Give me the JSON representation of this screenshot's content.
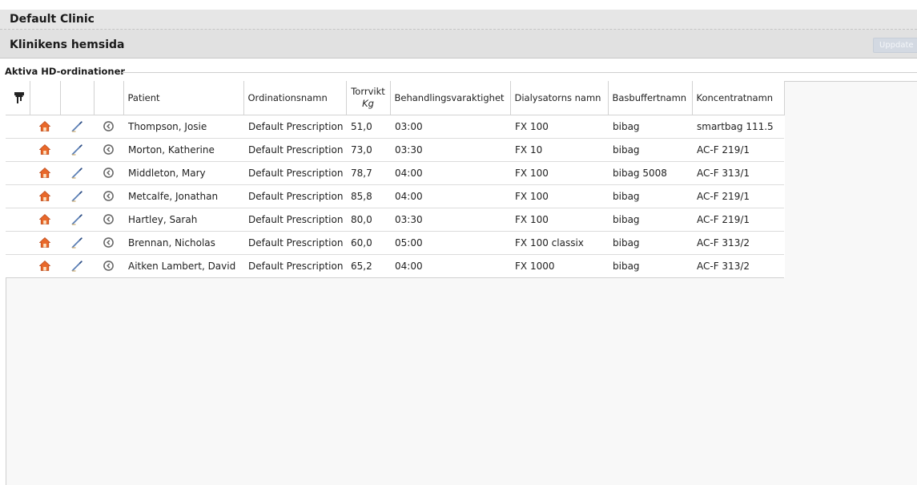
{
  "header": {
    "clinic_name": "Default Clinic",
    "home_title": "Klinikens hemsida",
    "update_label": "Uppdate"
  },
  "section": {
    "title": "Aktiva HD-ordinationer"
  },
  "table": {
    "columns": {
      "patient": "Patient",
      "prescription": "Ordinationsnamn",
      "dry_weight": "Torrvikt",
      "dry_weight_unit": "Kg",
      "duration": "Behandlingsvaraktighet",
      "dialyzer": "Dialysatorns namn",
      "base_buffer": "Basbuffertnamn",
      "concentrate": "Koncentratnamn"
    },
    "rows": [
      {
        "patient": "Thompson, Josie",
        "prescription": "Default Prescription",
        "dry_weight": "51,0",
        "duration": "03:00",
        "dialyzer": "FX 100",
        "base_buffer": "bibag",
        "concentrate": "smartbag 111.5"
      },
      {
        "patient": "Morton, Katherine",
        "prescription": "Default Prescription",
        "dry_weight": "73,0",
        "duration": "03:30",
        "dialyzer": "FX 10",
        "base_buffer": "bibag",
        "concentrate": "AC-F 219/1"
      },
      {
        "patient": "Middleton, Mary",
        "prescription": "Default Prescription",
        "dry_weight": "78,7",
        "duration": "04:00",
        "dialyzer": "FX 100",
        "base_buffer": "bibag 5008",
        "concentrate": "AC-F 313/1"
      },
      {
        "patient": "Metcalfe, Jonathan",
        "prescription": "Default Prescription",
        "dry_weight": "85,8",
        "duration": "04:00",
        "dialyzer": "FX 100",
        "base_buffer": "bibag",
        "concentrate": "AC-F 219/1"
      },
      {
        "patient": "Hartley, Sarah",
        "prescription": "Default Prescription",
        "dry_weight": "80,0",
        "duration": "03:30",
        "dialyzer": "FX 100",
        "base_buffer": "bibag",
        "concentrate": "AC-F 219/1"
      },
      {
        "patient": "Brennan, Nicholas",
        "prescription": "Default Prescription",
        "dry_weight": "60,0",
        "duration": "05:00",
        "dialyzer": "FX 100 classix",
        "base_buffer": "bibag",
        "concentrate": "AC-F 313/2"
      },
      {
        "patient": "Aitken Lambert, David",
        "prescription": "Default Prescription",
        "dry_weight": "65,2",
        "duration": "04:00",
        "dialyzer": "FX 1000",
        "base_buffer": "bibag",
        "concentrate": "AC-F 313/2"
      }
    ]
  },
  "icons": {
    "filter": "filter-icon",
    "home": "home-icon",
    "pen": "pen-icon",
    "clock": "clock-icon"
  },
  "colors": {
    "home_icon": "#e8682a",
    "pen_icon": "#5b7fb5",
    "clock_icon": "#6b6b6b",
    "update_button": "#d3d9e2"
  }
}
